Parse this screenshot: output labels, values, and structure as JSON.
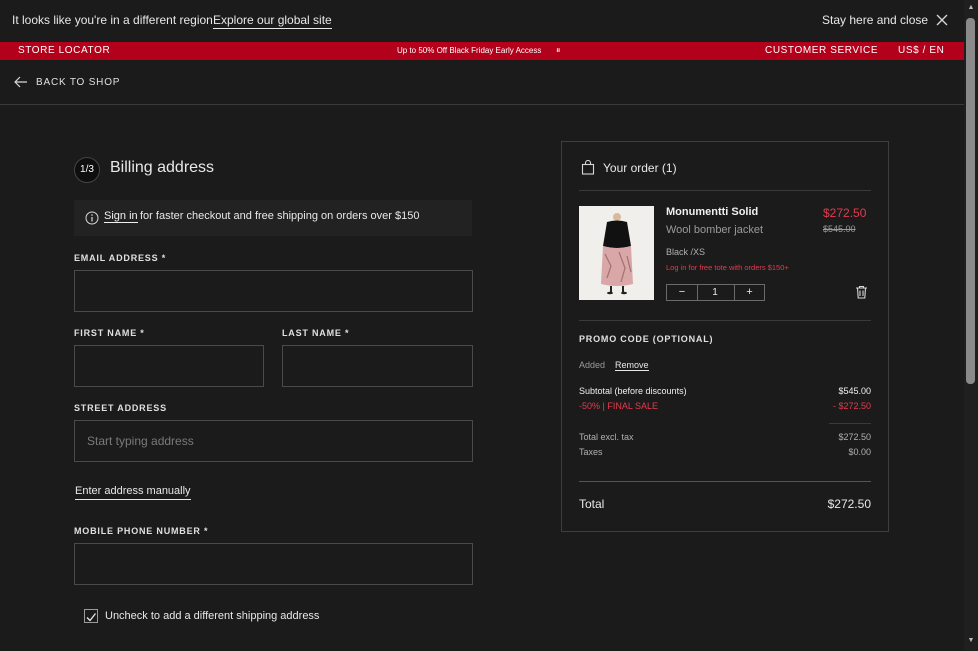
{
  "region_banner": {
    "message": "It looks like you're in a different region",
    "global_link": "Explore our global site",
    "stay_label": "Stay here and close"
  },
  "promo_strip": {
    "store_locator": "STORE LOCATOR",
    "announcement": "Up to 50% Off Black Friday Early Access",
    "pause_glyph": "⏸",
    "customer_service": "CUSTOMER SERVICE",
    "currency_lang": "US$ / EN"
  },
  "nav": {
    "back_label": "BACK TO SHOP"
  },
  "billing": {
    "step": "1/3",
    "title": "Billing address",
    "signin_link": "Sign in",
    "signin_text": "for faster checkout and free shipping on orders over $150",
    "email_label": "EMAIL ADDRESS *",
    "email_value": "",
    "first_name_label": "FIRST NAME *",
    "first_name_value": "",
    "last_name_label": "LAST NAME *",
    "last_name_value": "",
    "street_label": "STREET ADDRESS",
    "street_placeholder": "Start typing address",
    "manual_link": "Enter address manually",
    "phone_label": "MOBILE PHONE NUMBER *",
    "phone_value": "",
    "shipping_checkbox_label": "Uncheck to add a different shipping address",
    "shipping_checked": true
  },
  "order": {
    "title": "Your order (1)",
    "item": {
      "name": "Monumentti Solid",
      "subtitle": "Wool bomber jacket",
      "price": "$272.50",
      "original_price": "$545.00",
      "variant": "Black /XS",
      "note": "Log in for free tote with orders $150+",
      "quantity": "1",
      "minus": "−",
      "plus": "+"
    },
    "promo_label": "PROMO CODE (OPTIONAL)",
    "promo_added": "Added",
    "promo_remove": "Remove",
    "subtotal_label": "Subtotal (before discounts)",
    "subtotal_value": "$545.00",
    "discount_label": "-50% | FINAL SALE",
    "discount_value": "- $272.50",
    "total_excl_label": "Total excl. tax",
    "total_excl_value": "$272.50",
    "taxes_label": "Taxes",
    "taxes_value": "$0.00",
    "total_label": "Total",
    "total_value": "$272.50"
  },
  "colors": {
    "accent_red": "#b3001b",
    "sale_red": "#e8394d",
    "background": "#1b1b1b"
  }
}
